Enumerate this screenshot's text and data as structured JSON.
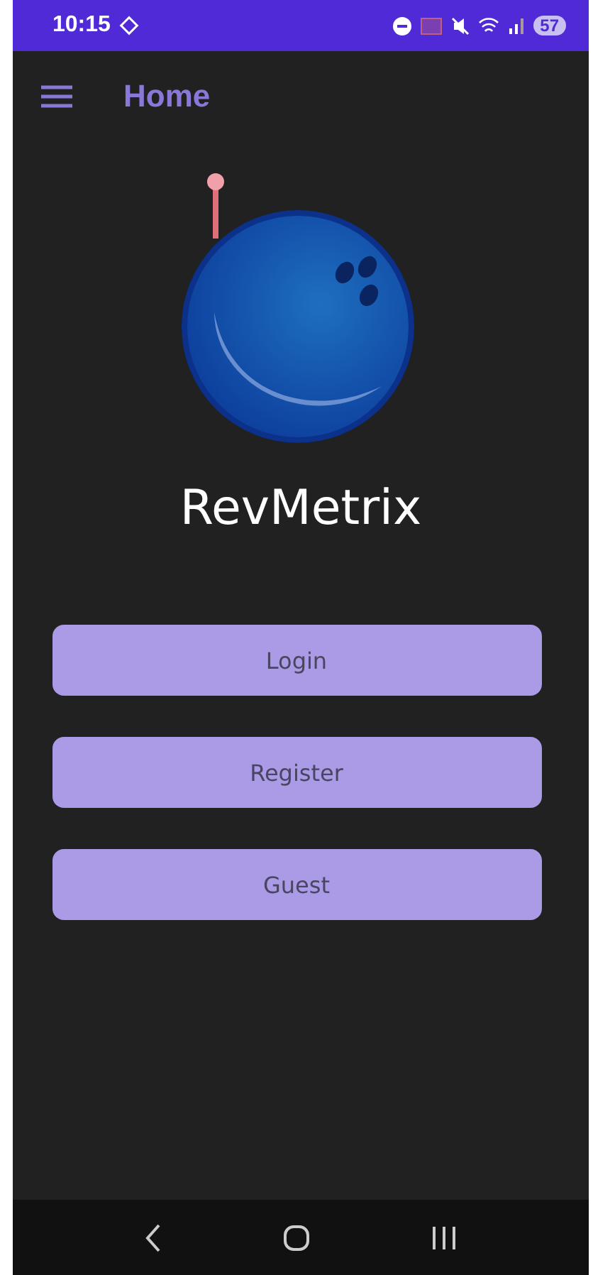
{
  "status_bar": {
    "time": "10:15",
    "battery": "57"
  },
  "toolbar": {
    "title": "Home"
  },
  "app_name": "RevMetrix",
  "buttons": [
    {
      "label": "Login"
    },
    {
      "label": "Register"
    },
    {
      "label": "Guest"
    }
  ]
}
